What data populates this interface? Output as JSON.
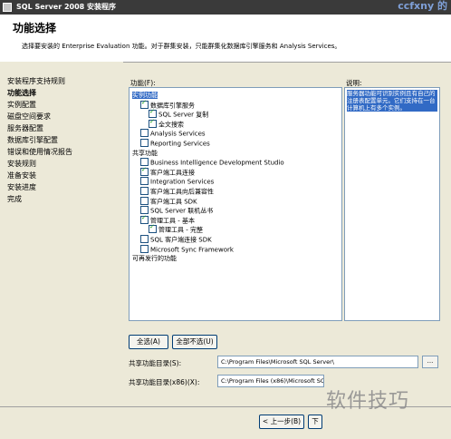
{
  "window": {
    "title": "SQL Server 2008 安装程序",
    "watermark_top": "ccfxny 的"
  },
  "header": {
    "title": "功能选择",
    "description": "选择要安装的 Enterprise Evaluation 功能。对于群集安装，只能群集化数据库引擎服务和 Analysis Services。"
  },
  "nav": {
    "items": [
      {
        "label": "安装程序支持规则",
        "active": false
      },
      {
        "label": "功能选择",
        "active": true
      },
      {
        "label": "实例配置",
        "active": false
      },
      {
        "label": "磁盘空间要求",
        "active": false
      },
      {
        "label": "服务器配置",
        "active": false
      },
      {
        "label": "数据库引擎配置",
        "active": false
      },
      {
        "label": "错误和使用情况报告",
        "active": false
      },
      {
        "label": "安装规则",
        "active": false
      },
      {
        "label": "准备安装",
        "active": false
      },
      {
        "label": "安装进度",
        "active": false
      },
      {
        "label": "完成",
        "active": false
      }
    ]
  },
  "features": {
    "label": "功能(F):",
    "items": [
      {
        "label": "实例功能",
        "indent": 0,
        "checkbox": false,
        "checked": false,
        "selected": true
      },
      {
        "label": "数据库引擎服务",
        "indent": 1,
        "checkbox": true,
        "checked": true
      },
      {
        "label": "SQL Server 复制",
        "indent": 2,
        "checkbox": true,
        "checked": true
      },
      {
        "label": "全文搜索",
        "indent": 2,
        "checkbox": true,
        "checked": true
      },
      {
        "label": "Analysis Services",
        "indent": 1,
        "checkbox": true,
        "checked": false
      },
      {
        "label": "Reporting Services",
        "indent": 1,
        "checkbox": true,
        "checked": false
      },
      {
        "label": "共享功能",
        "indent": 0,
        "checkbox": false,
        "checked": false
      },
      {
        "label": "Business Intelligence Development Studio",
        "indent": 1,
        "checkbox": true,
        "checked": false
      },
      {
        "label": "客户端工具连接",
        "indent": 1,
        "checkbox": true,
        "checked": true
      },
      {
        "label": "Integration Services",
        "indent": 1,
        "checkbox": true,
        "checked": false
      },
      {
        "label": "客户端工具向后兼容性",
        "indent": 1,
        "checkbox": true,
        "checked": false
      },
      {
        "label": "客户端工具 SDK",
        "indent": 1,
        "checkbox": true,
        "checked": false
      },
      {
        "label": "SQL Server 联机丛书",
        "indent": 1,
        "checkbox": true,
        "checked": false
      },
      {
        "label": "管理工具 - 基本",
        "indent": 1,
        "checkbox": true,
        "checked": true
      },
      {
        "label": "管理工具 - 完整",
        "indent": 2,
        "checkbox": true,
        "checked": true
      },
      {
        "label": "SQL 客户端连接 SDK",
        "indent": 1,
        "checkbox": true,
        "checked": false
      },
      {
        "label": "Microsoft Sync Framework",
        "indent": 1,
        "checkbox": true,
        "checked": false
      },
      {
        "label": "可再发行的功能",
        "indent": 0,
        "checkbox": false,
        "checked": false
      }
    ]
  },
  "description": {
    "label": "说明:",
    "text": "服务器功能可识别实例且有自己的注册表配置单元。它们支持在一台计算机上有多个实例。"
  },
  "buttons": {
    "select_all": "全选(A)",
    "unselect_all": "全部不选(U)"
  },
  "shared_dir": {
    "label": "共享功能目录(S):",
    "value": "C:\\Program Files\\Microsoft SQL Server\\",
    "browse": "..."
  },
  "shared_dir_x86": {
    "label": "共享功能目录(x86)(X):",
    "value": "C:\\Program Files (x86)\\Microsoft SQL Server\\"
  },
  "footer": {
    "back": "< 上一步(B)",
    "next_partial": "下"
  },
  "watermark": "软件技巧"
}
